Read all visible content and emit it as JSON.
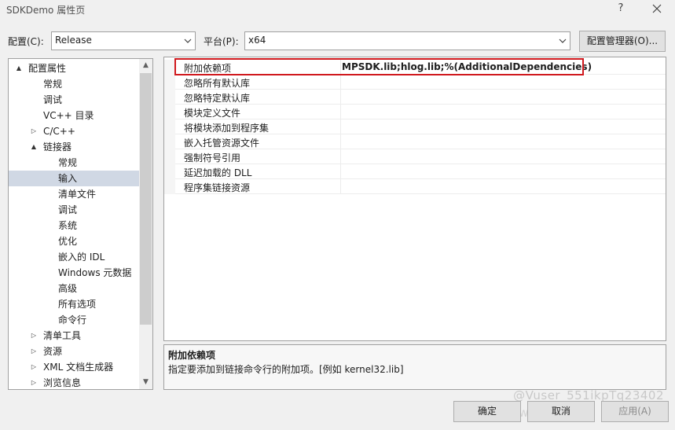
{
  "window": {
    "title": "SDKDemo 属性页",
    "help_glyph": "?"
  },
  "toolbar": {
    "config_label": "配置(C):",
    "config_value": "Release",
    "platform_label": "平台(P):",
    "platform_value": "x64",
    "config_manager_button": "配置管理器(O)..."
  },
  "tree": {
    "items": [
      {
        "label": "配置属性",
        "level": 0,
        "expander": "▲",
        "selected": false
      },
      {
        "label": "常规",
        "level": 1,
        "expander": "",
        "selected": false
      },
      {
        "label": "调试",
        "level": 1,
        "expander": "",
        "selected": false
      },
      {
        "label": "VC++ 目录",
        "level": 1,
        "expander": "",
        "selected": false
      },
      {
        "label": "C/C++",
        "level": 1,
        "expander": "▷",
        "selected": false
      },
      {
        "label": "链接器",
        "level": 1,
        "expander": "▲",
        "selected": false
      },
      {
        "label": "常规",
        "level": 2,
        "expander": "",
        "selected": false
      },
      {
        "label": "输入",
        "level": 2,
        "expander": "",
        "selected": true
      },
      {
        "label": "清单文件",
        "level": 2,
        "expander": "",
        "selected": false
      },
      {
        "label": "调试",
        "level": 2,
        "expander": "",
        "selected": false
      },
      {
        "label": "系统",
        "level": 2,
        "expander": "",
        "selected": false
      },
      {
        "label": "优化",
        "level": 2,
        "expander": "",
        "selected": false
      },
      {
        "label": "嵌入的 IDL",
        "level": 2,
        "expander": "",
        "selected": false
      },
      {
        "label": "Windows 元数据",
        "level": 2,
        "expander": "",
        "selected": false
      },
      {
        "label": "高级",
        "level": 2,
        "expander": "",
        "selected": false
      },
      {
        "label": "所有选项",
        "level": 2,
        "expander": "",
        "selected": false
      },
      {
        "label": "命令行",
        "level": 2,
        "expander": "",
        "selected": false
      },
      {
        "label": "清单工具",
        "level": 1,
        "expander": "▷",
        "selected": false
      },
      {
        "label": "资源",
        "level": 1,
        "expander": "▷",
        "selected": false
      },
      {
        "label": "XML 文档生成器",
        "level": 1,
        "expander": "▷",
        "selected": false
      },
      {
        "label": "浏览信息",
        "level": 1,
        "expander": "▷",
        "selected": false
      }
    ]
  },
  "properties": {
    "rows": [
      {
        "name": "附加依赖项",
        "value": "MPSDK.lib;hlog.lib;%(AdditionalDependencies)",
        "bold": true
      },
      {
        "name": "忽略所有默认库",
        "value": "",
        "bold": false
      },
      {
        "name": "忽略特定默认库",
        "value": "",
        "bold": false
      },
      {
        "name": "模块定义文件",
        "value": "",
        "bold": false
      },
      {
        "name": "将模块添加到程序集",
        "value": "",
        "bold": false
      },
      {
        "name": "嵌入托管资源文件",
        "value": "",
        "bold": false
      },
      {
        "name": "强制符号引用",
        "value": "",
        "bold": false
      },
      {
        "name": "延迟加载的 DLL",
        "value": "",
        "bold": false
      },
      {
        "name": "程序集链接资源",
        "value": "",
        "bold": false
      }
    ]
  },
  "description": {
    "title": "附加依赖项",
    "text": "指定要添加到链接命令行的附加项。[例如 kernel32.lib]"
  },
  "buttons": {
    "ok": "确定",
    "cancel": "取消",
    "apply": "应用(A)"
  },
  "watermark": {
    "line1": "@Vuser_551ikpTq23402",
    "line2": "www.yiyb.com"
  },
  "colors": {
    "highlight_border": "#d0191e",
    "selected_bg": "#d0d8e4"
  }
}
